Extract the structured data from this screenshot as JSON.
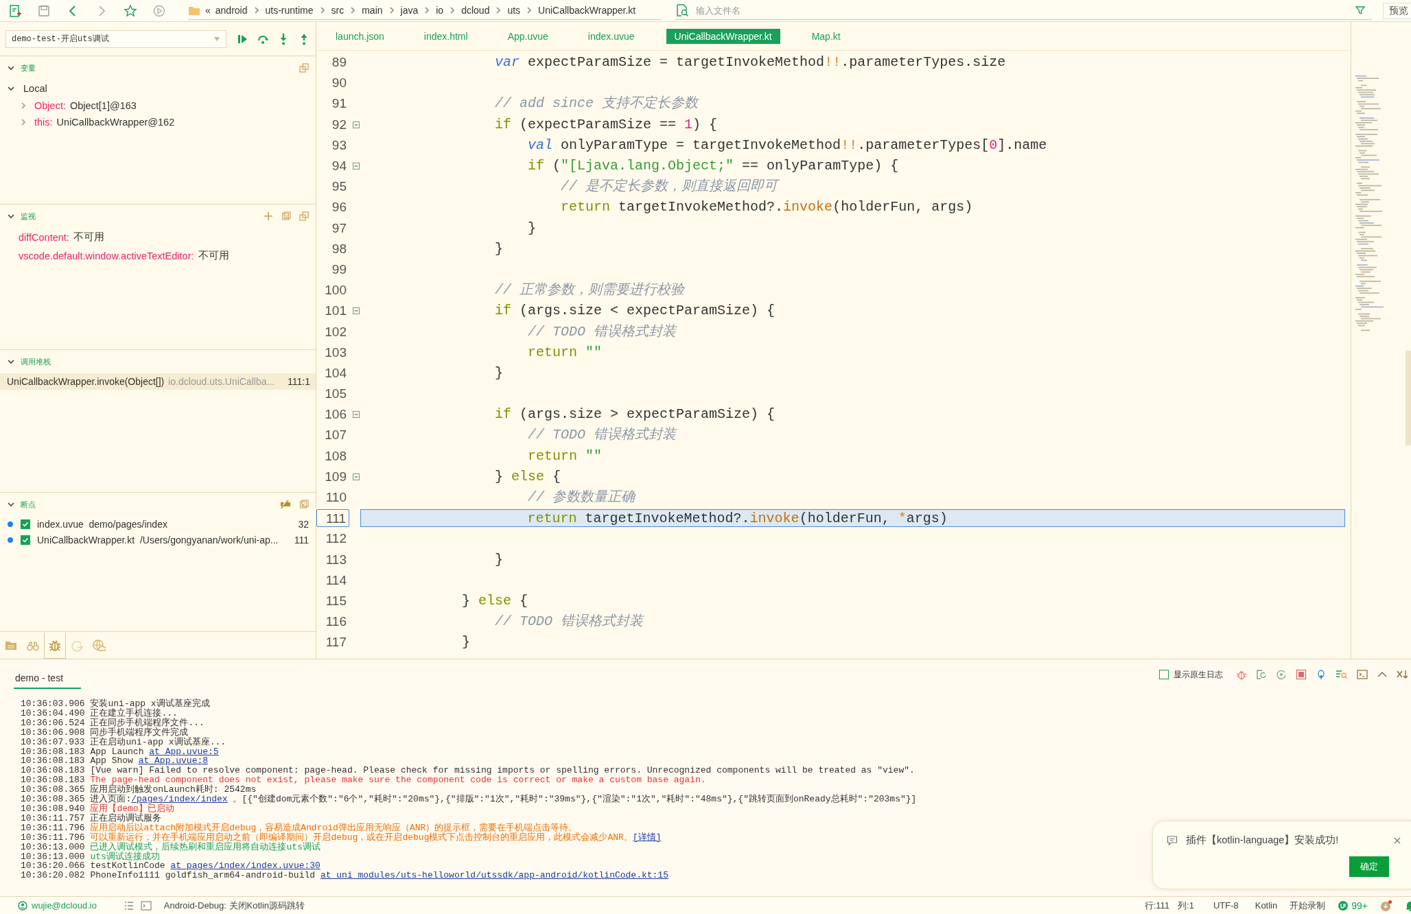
{
  "toolbar": {
    "breadcrumb_mark": "«",
    "breadcrumb": [
      "android",
      "uts-runtime",
      "src",
      "main",
      "java",
      "io",
      "dcloud",
      "uts",
      "UniCallbackWrapper.kt"
    ],
    "search": {
      "placeholder": "输入文件名"
    },
    "preview_button": "预览"
  },
  "debug": {
    "config": "demo-test-开启uts调试",
    "variables": {
      "title": "变量",
      "expanded": true,
      "scopes": [
        {
          "name": "Local",
          "expanded": true,
          "children": [
            {
              "name": "Object:",
              "value": "Object[1]@163",
              "expanded": false
            },
            {
              "name": "this:",
              "value": "UniCallbackWrapper@162",
              "expanded": false
            }
          ]
        }
      ]
    },
    "watch": {
      "title": "监视",
      "expanded": true,
      "items": [
        {
          "name": "diffContent:",
          "value": "不可用"
        },
        {
          "name": "vscode.default.window.activeTextEditor:",
          "value": "不可用"
        }
      ]
    },
    "call_stack": {
      "title": "调用堆栈",
      "expanded": true,
      "frames": [
        {
          "function": "UniCallbackWrapper.invoke(Object[])",
          "source": "io.dcloud.uts.UniCallba...",
          "location": "111:1",
          "selected": true
        }
      ]
    },
    "breakpoints": {
      "title": "断点",
      "expanded": true,
      "items": [
        {
          "file": "index.uvue",
          "path": "demo/pages/index",
          "line": "32",
          "checked": true
        },
        {
          "file": "UniCallbackWrapper.kt",
          "path": "/Users/gongyanan/work/uni-ap...",
          "line": "111",
          "checked": true
        }
      ]
    },
    "side_tabs": [
      {
        "kind": "files",
        "selected": false
      },
      {
        "kind": "search",
        "selected": false
      },
      {
        "kind": "debug",
        "selected": true
      },
      {
        "kind": "history",
        "selected": false
      },
      {
        "kind": "cloud",
        "selected": false
      }
    ]
  },
  "editor": {
    "tabs": [
      {
        "label": "launch.json",
        "selected": false
      },
      {
        "label": "index.html",
        "selected": false
      },
      {
        "label": "App.uvue",
        "selected": false
      },
      {
        "label": "index.uvue",
        "selected": false
      },
      {
        "label": "UniCallbackWrapper.kt",
        "selected": true
      },
      {
        "label": "Map.kt",
        "selected": false
      }
    ],
    "lines": [
      {
        "number": "89",
        "fold": false,
        "current": false,
        "tokens": [
          {
            "kind": "keyword",
            "text": "                var"
          },
          {
            "kind": "plain",
            "text": " expectParamSize = targetInvokeMethod"
          },
          {
            "kind": "operator",
            "text": "!!"
          },
          {
            "kind": "plain",
            "text": ".parameterTypes.size"
          }
        ]
      },
      {
        "number": "90",
        "fold": false,
        "current": false
      },
      {
        "number": "91",
        "fold": false,
        "current": false,
        "tokens": [
          {
            "kind": "comment",
            "text": "                // add since 支持不定长参数"
          }
        ]
      },
      {
        "number": "92",
        "fold": true,
        "current": false,
        "tokens": [
          {
            "kind": "control",
            "text": "                if"
          },
          {
            "kind": "plain",
            "text": " (expectParamSize == "
          },
          {
            "kind": "number",
            "text": "1"
          },
          {
            "kind": "plain",
            "text": ") {"
          }
        ]
      },
      {
        "number": "93",
        "fold": false,
        "current": false,
        "tokens": [
          {
            "kind": "keyword",
            "text": "                    val"
          },
          {
            "kind": "plain",
            "text": " onlyParamType = targetInvokeMethod"
          },
          {
            "kind": "operator",
            "text": "!!"
          },
          {
            "kind": "plain",
            "text": ".parameterTypes["
          },
          {
            "kind": "number",
            "text": "0"
          },
          {
            "kind": "plain",
            "text": "].name"
          }
        ]
      },
      {
        "number": "94",
        "fold": true,
        "current": false,
        "tokens": [
          {
            "kind": "control",
            "text": "                    if"
          },
          {
            "kind": "plain",
            "text": " ("
          },
          {
            "kind": "string",
            "text": "\"[Ljava.lang.Object;\""
          },
          {
            "kind": "plain",
            "text": " == onlyParamType) {"
          }
        ]
      },
      {
        "number": "95",
        "fold": false,
        "current": false,
        "tokens": [
          {
            "kind": "comment",
            "text": "                        // 是不定长参数，则直接返回即可"
          }
        ]
      },
      {
        "number": "96",
        "fold": false,
        "current": false,
        "tokens": [
          {
            "kind": "control",
            "text": "                        return"
          },
          {
            "kind": "plain",
            "text": " targetInvokeMethod?."
          },
          {
            "kind": "call",
            "text": "invoke"
          },
          {
            "kind": "plain",
            "text": "(holderFun, args)"
          }
        ]
      },
      {
        "number": "97",
        "fold": false,
        "current": false,
        "tokens": [
          {
            "kind": "plain",
            "text": "                    }"
          }
        ]
      },
      {
        "number": "98",
        "fold": false,
        "current": false,
        "tokens": [
          {
            "kind": "plain",
            "text": "                }"
          }
        ]
      },
      {
        "number": "99",
        "fold": false,
        "current": false
      },
      {
        "number": "100",
        "fold": false,
        "current": false,
        "tokens": [
          {
            "kind": "comment",
            "text": "                // 正常参数，则需要进行校验"
          }
        ]
      },
      {
        "number": "101",
        "fold": true,
        "current": false,
        "tokens": [
          {
            "kind": "control",
            "text": "                if"
          },
          {
            "kind": "plain",
            "text": " (args.size < expectParamSize) {"
          }
        ]
      },
      {
        "number": "102",
        "fold": false,
        "current": false,
        "tokens": [
          {
            "kind": "comment",
            "text": "                    // TODO 错误格式封装"
          }
        ]
      },
      {
        "number": "103",
        "fold": false,
        "current": false,
        "tokens": [
          {
            "kind": "control",
            "text": "                    return"
          },
          {
            "kind": "string",
            "text": " \"\""
          }
        ]
      },
      {
        "number": "104",
        "fold": false,
        "current": false,
        "tokens": [
          {
            "kind": "plain",
            "text": "                }"
          }
        ]
      },
      {
        "number": "105",
        "fold": false,
        "current": false
      },
      {
        "number": "106",
        "fold": true,
        "current": false,
        "tokens": [
          {
            "kind": "control",
            "text": "                if"
          },
          {
            "kind": "plain",
            "text": " (args.size > expectParamSize) {"
          }
        ]
      },
      {
        "number": "107",
        "fold": false,
        "current": false,
        "tokens": [
          {
            "kind": "comment",
            "text": "                    // TODO 错误格式封装"
          }
        ]
      },
      {
        "number": "108",
        "fold": false,
        "current": false,
        "tokens": [
          {
            "kind": "control",
            "text": "                    return"
          },
          {
            "kind": "string",
            "text": " \"\""
          }
        ]
      },
      {
        "number": "109",
        "fold": true,
        "current": false,
        "tokens": [
          {
            "kind": "plain",
            "text": "                } "
          },
          {
            "kind": "control",
            "text": "else"
          },
          {
            "kind": "plain",
            "text": " {"
          }
        ]
      },
      {
        "number": "110",
        "fold": false,
        "current": false,
        "tokens": [
          {
            "kind": "comment",
            "text": "                    // 参数数量正确"
          }
        ]
      },
      {
        "number": "111",
        "fold": false,
        "current": true,
        "tokens": [
          {
            "kind": "control",
            "text": "                    return"
          },
          {
            "kind": "plain",
            "text": " targetInvokeMethod?."
          },
          {
            "kind": "call",
            "text": "invoke"
          },
          {
            "kind": "plain",
            "text": "(holderFun, "
          },
          {
            "kind": "operator",
            "text": "*"
          },
          {
            "kind": "plain",
            "text": "args)"
          }
        ]
      },
      {
        "number": "112",
        "fold": false,
        "current": false
      },
      {
        "number": "113",
        "fold": false,
        "current": false,
        "tokens": [
          {
            "kind": "plain",
            "text": "                }"
          }
        ]
      },
      {
        "number": "114",
        "fold": false,
        "current": false
      },
      {
        "number": "115",
        "fold": false,
        "current": false,
        "tokens": [
          {
            "kind": "plain",
            "text": "            } "
          },
          {
            "kind": "control",
            "text": "else"
          },
          {
            "kind": "plain",
            "text": " {"
          }
        ]
      },
      {
        "number": "116",
        "fold": false,
        "current": false,
        "tokens": [
          {
            "kind": "comment",
            "text": "                // TODO 错误格式封装"
          }
        ]
      },
      {
        "number": "117",
        "fold": false,
        "current": false,
        "tokens": [
          {
            "kind": "plain",
            "text": "            }"
          }
        ]
      }
    ]
  },
  "console": {
    "tab": "demo - test",
    "show_native_log": {
      "label": "显示原生日志",
      "checked": false
    },
    "lines": [
      {
        "time": "10:36:03.906",
        "kind": "info",
        "parts": [
          {
            "text": "安装uni-app x调试基座完成"
          }
        ]
      },
      {
        "time": "10:36:04.490",
        "kind": "info",
        "parts": [
          {
            "text": "正在建立手机连接..."
          }
        ]
      },
      {
        "time": "10:36:06.524",
        "kind": "info",
        "parts": [
          {
            "text": "正在同步手机端程序文件..."
          }
        ]
      },
      {
        "time": "10:36:06.908",
        "kind": "info",
        "parts": [
          {
            "text": "同步手机端程序文件完成"
          }
        ]
      },
      {
        "time": "10:36:07.933",
        "kind": "info",
        "parts": [
          {
            "text": "正在启动uni-app x调试基座..."
          }
        ]
      },
      {
        "time": "10:36:08.183",
        "kind": "info",
        "parts": [
          {
            "text": "App Launch "
          },
          {
            "text": "at App.uvue:5",
            "link": true
          }
        ]
      },
      {
        "time": "10:36:08.183",
        "kind": "info",
        "parts": [
          {
            "text": "App Show "
          },
          {
            "text": "at App.uvue:8",
            "link": true
          }
        ]
      },
      {
        "time": "10:36:08.183",
        "kind": "info",
        "parts": [
          {
            "text": "[Vue warn] Failed to resolve component: page-head. Please check for missing imports or spelling errors. Unrecognized components will be treated as \"view\"."
          }
        ]
      },
      {
        "time": "10:36:08.183",
        "kind": "error",
        "parts": [
          {
            "text": "The page-head component does not exist, please make sure the component code is correct or make a custom base again."
          }
        ]
      },
      {
        "time": "10:36:08.365",
        "kind": "info",
        "parts": [
          {
            "text": "应用启动到触发onLaunch耗时: 2542ms"
          }
        ]
      },
      {
        "time": "10:36:08.365",
        "kind": "info",
        "parts": [
          {
            "text": "进入页面:"
          },
          {
            "text": "/pages/index/index",
            "link": true
          },
          {
            "text": " 。[{\"创建dom元素个数\":\"6个\",\"耗时\":\"20ms\"},{\"排版\":\"1次\",\"耗时\":\"39ms\"},{\"渲染\":\"1次\",\"耗时\":\"48ms\"},{\"跳转页面到onReady总耗时\":\"203ms\"}]"
          }
        ]
      },
      {
        "time": "10:36:08.940",
        "kind": "error",
        "parts": [
          {
            "text": "应用【demo】已启动"
          }
        ]
      },
      {
        "time": "10:36:11.757",
        "kind": "info",
        "parts": [
          {
            "text": "正在启动调试服务"
          }
        ]
      },
      {
        "time": "10:36:11.796",
        "kind": "warning",
        "parts": [
          {
            "text": "应用启动后以attach附加模式开启debug，容易造成Android弹出应用无响应（ANR）的提示框，需要在手机端点击等待。"
          }
        ]
      },
      {
        "time": "10:36:11.796",
        "kind": "warning",
        "parts": [
          {
            "text": "可以重新运行，并在手机端应用启动之前（即编译期间）开启debug，或在开启debug模式下点击控制台的重启应用，此模式会减少ANR。"
          },
          {
            "text": "[详情]",
            "link": true
          }
        ]
      },
      {
        "time": "10:36:13.000",
        "kind": "success",
        "parts": [
          {
            "text": "已进入调试模式，后续热刷和重启应用将自动连接uts调试"
          }
        ]
      },
      {
        "time": "10:36:13.000",
        "kind": "success",
        "parts": [
          {
            "text": "uts调试连接成功"
          }
        ]
      },
      {
        "time": "10:36:20.066",
        "kind": "info",
        "parts": [
          {
            "text": "testKotlinCode "
          },
          {
            "text": "at pages/index/index.uvue:30",
            "link": true
          }
        ]
      },
      {
        "time": "10:36:20.082",
        "kind": "info",
        "parts": [
          {
            "text": "PhoneInfo1111 goldfish_arm64-android-build "
          },
          {
            "text": "at uni_modules/uts-helloworld/utssdk/app-android/kotlinCode.kt:15",
            "link": true
          }
        ]
      }
    ]
  },
  "notification": {
    "message": "插件【kotlin-language】安装成功!",
    "button": "确定"
  },
  "status_bar": {
    "user": "wujie@dcloud.io",
    "message": "Android-Debug: 关闭Kotlin源码跳转",
    "line": "行:111",
    "column": "列:1",
    "encoding": "UTF-8",
    "language": "Kotlin",
    "record": "开始录制",
    "badge": "99+"
  }
}
